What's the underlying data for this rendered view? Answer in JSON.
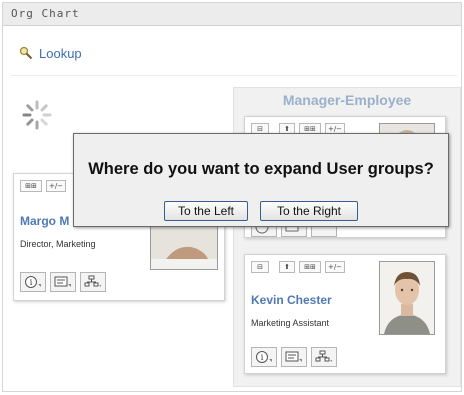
{
  "window": {
    "title": "Org Chart"
  },
  "toolbar": {
    "lookup_label": "Lookup"
  },
  "panel": {
    "title": "Manager-Employee"
  },
  "cards": {
    "left": {
      "name": "Margo M",
      "role": "Director, Marketing"
    },
    "bottom": {
      "name": "Kevin Chester",
      "role": "Marketing Assistant"
    }
  },
  "dialog": {
    "question": "Where do you want to expand User groups?",
    "left_button": "To the Left",
    "right_button": "To the Right"
  },
  "icons": [
    "search-icon",
    "loading-spinner-icon",
    "expand-group-icon",
    "collapse-icon",
    "up-arrow-icon",
    "info-icon",
    "vcard-icon",
    "org-chart-icon"
  ],
  "colors": {
    "link": "#3a6fb0",
    "name": "#4f79b2",
    "panel_title": "#9bb0c9",
    "dialog_bg": "#efefef"
  }
}
